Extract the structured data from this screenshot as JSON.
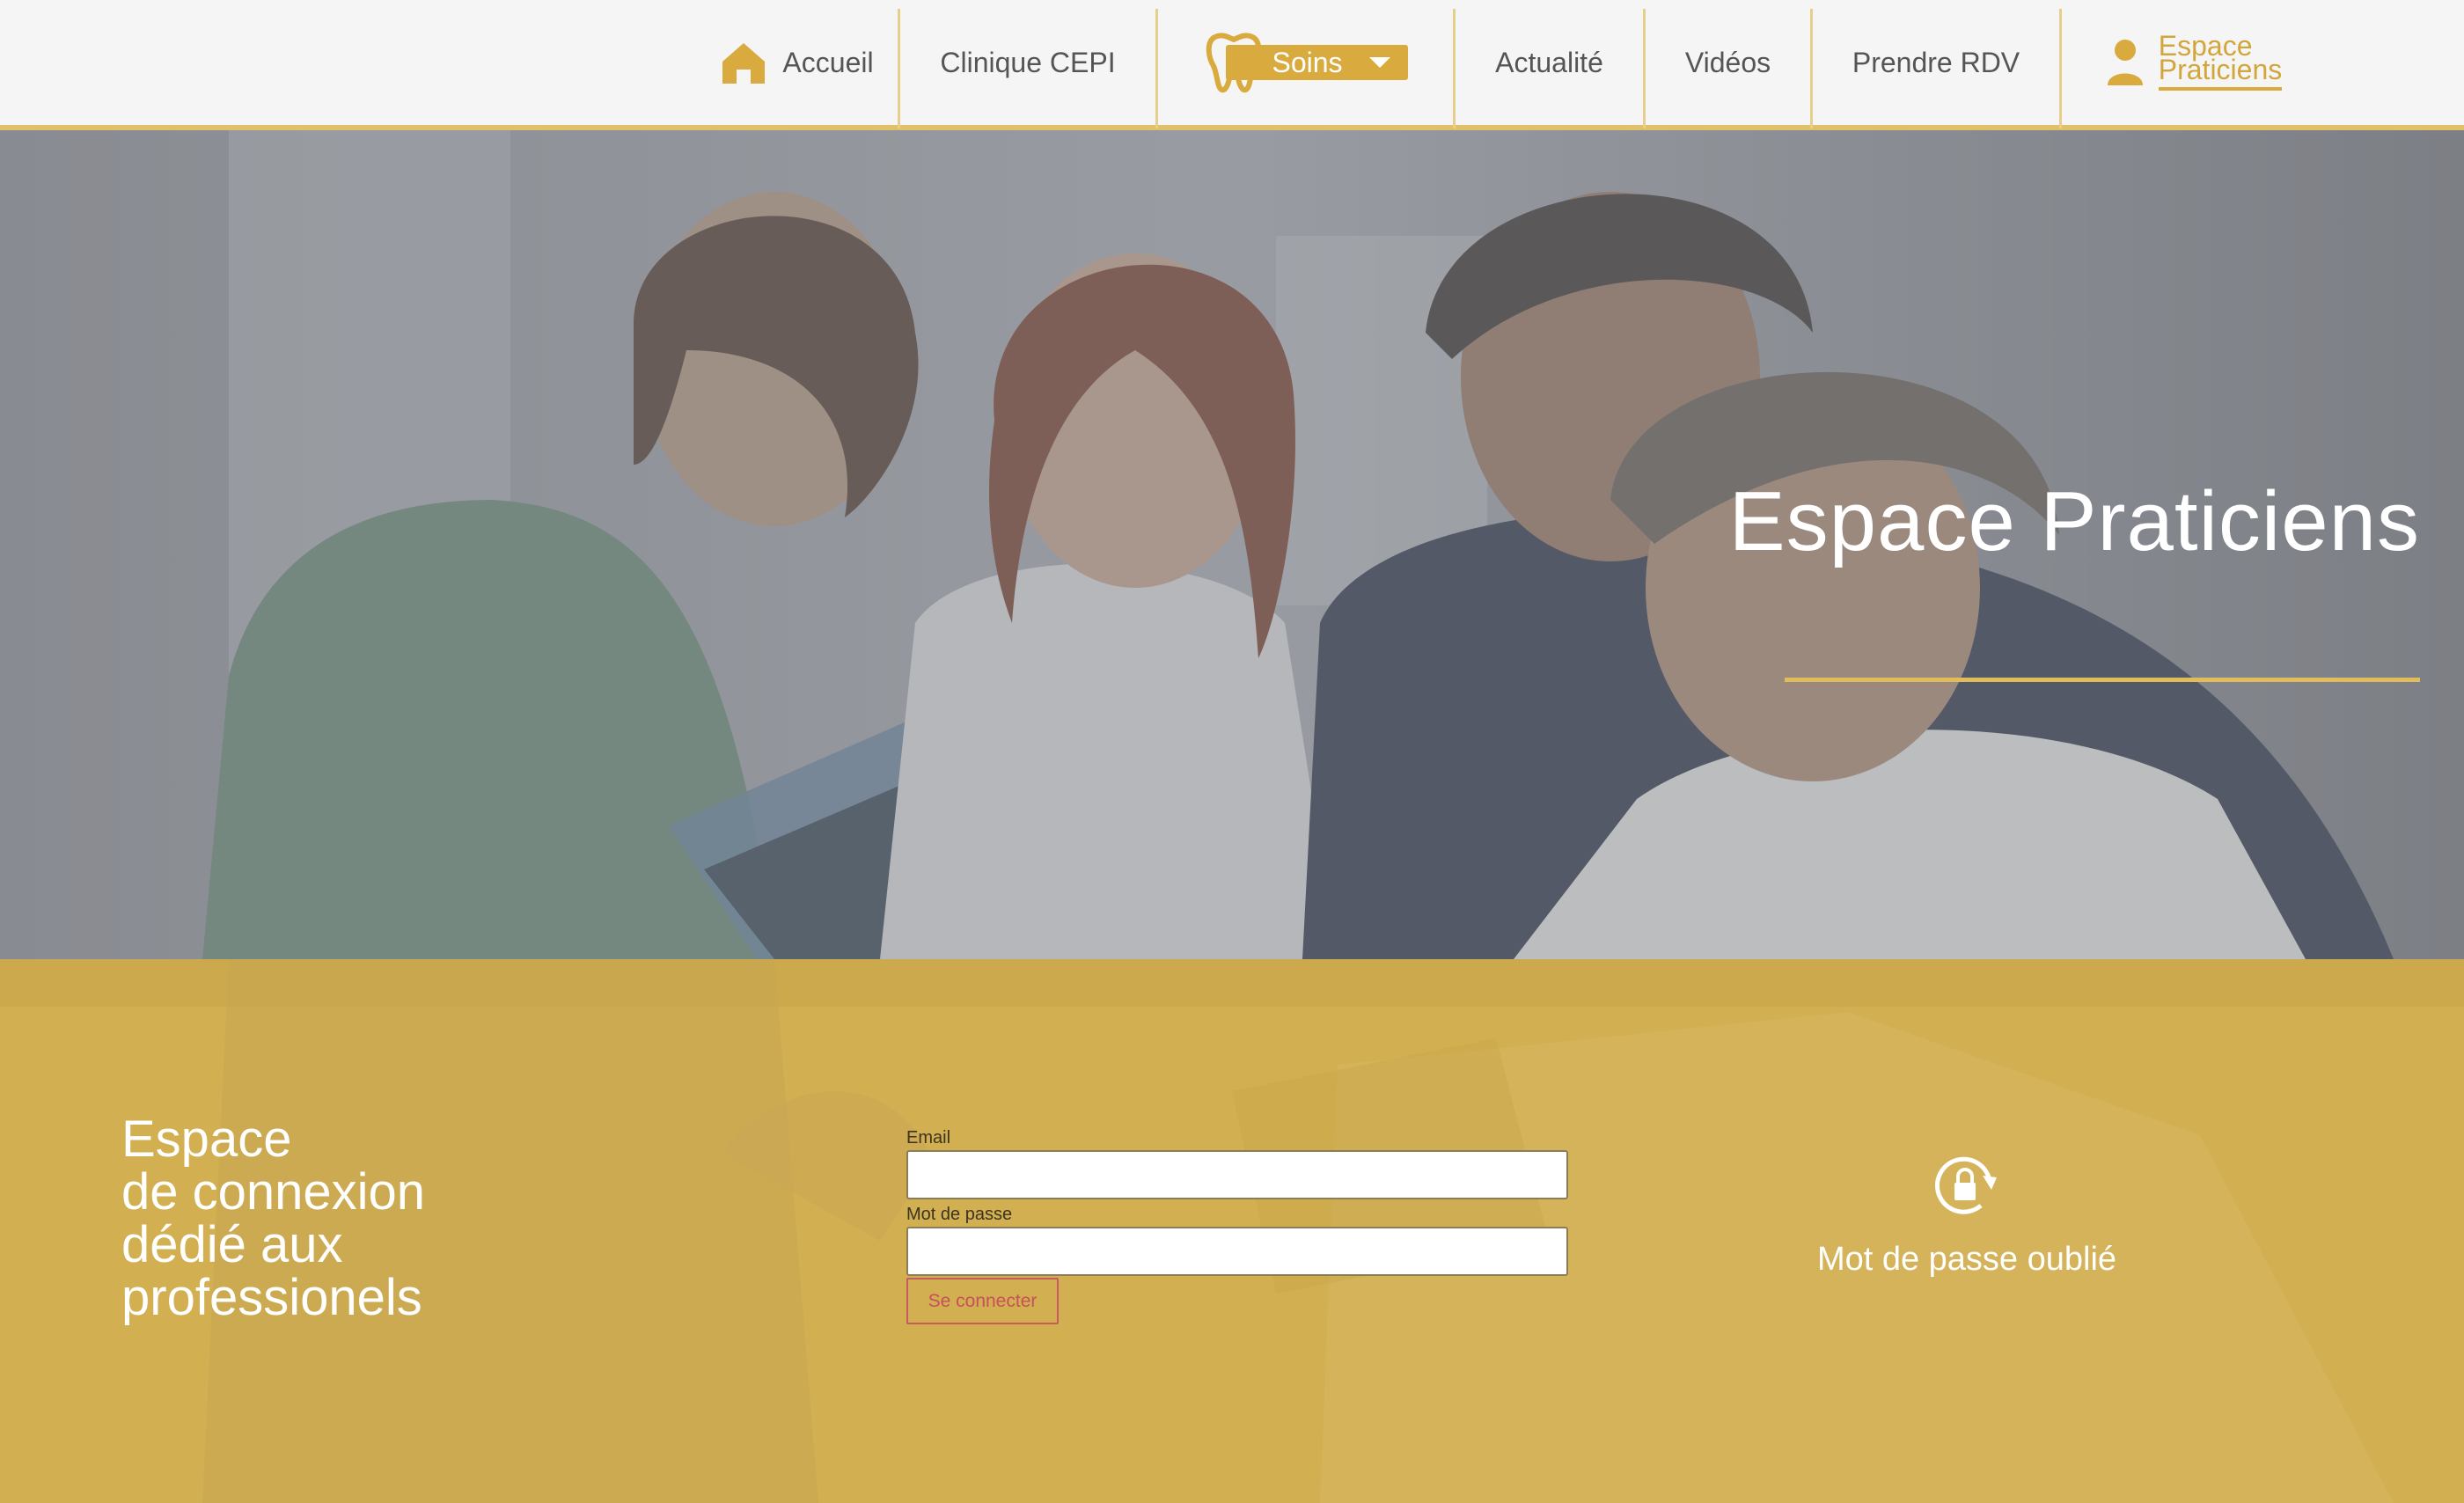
{
  "nav": {
    "items": [
      {
        "label": "Accueil",
        "icon": "home-icon"
      },
      {
        "label": "Clinique CEPI"
      },
      {
        "label": "Soins",
        "icon": "tooth-icon"
      },
      {
        "label": "Actualité"
      },
      {
        "label": "Vidéos"
      },
      {
        "label": "Prendre RDV"
      },
      {
        "label_line1": "Espace",
        "label_line2": "Praticiens",
        "icon": "user-icon"
      }
    ]
  },
  "hero": {
    "title": "Espace Praticiens"
  },
  "login": {
    "intro": [
      "Espace",
      "de connexion",
      "dédié aux",
      "professionels"
    ],
    "email_label": "Email",
    "email_value": "",
    "password_label": "Mot de passe",
    "password_value": "",
    "submit_label": "Se connecter",
    "forgot_label": "Mot de passe oublié",
    "forgot_icon": "lock-reset-icon"
  },
  "colors": {
    "accent": "#d9ab3f",
    "login_bg": "#d2af50",
    "nav_bg": "#f5f5f5",
    "connect_button": "#c75a63"
  }
}
